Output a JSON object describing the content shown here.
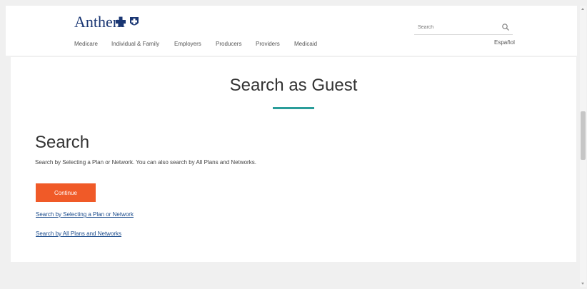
{
  "header": {
    "logo_text": "Anthem",
    "nav": [
      {
        "label": "Medicare"
      },
      {
        "label": "Individual & Family"
      },
      {
        "label": "Employers"
      },
      {
        "label": "Producers"
      },
      {
        "label": "Providers"
      },
      {
        "label": "Medicaid"
      }
    ],
    "search_placeholder": "Search",
    "language_link": "Español"
  },
  "main": {
    "page_title": "Search as Guest",
    "section_title": "Search",
    "section_description": "Search by Selecting a Plan or Network. You can also search by All Plans and Networks.",
    "continue_label": "Continue",
    "link_plan_network": "Search by Selecting a Plan or Network",
    "link_all_plans": "Search by All Plans and Networks"
  },
  "colors": {
    "brand_blue": "#1a3673",
    "accent_teal": "#2a9d9a",
    "button_orange": "#f05a28",
    "link_blue": "#1a4b8c"
  }
}
